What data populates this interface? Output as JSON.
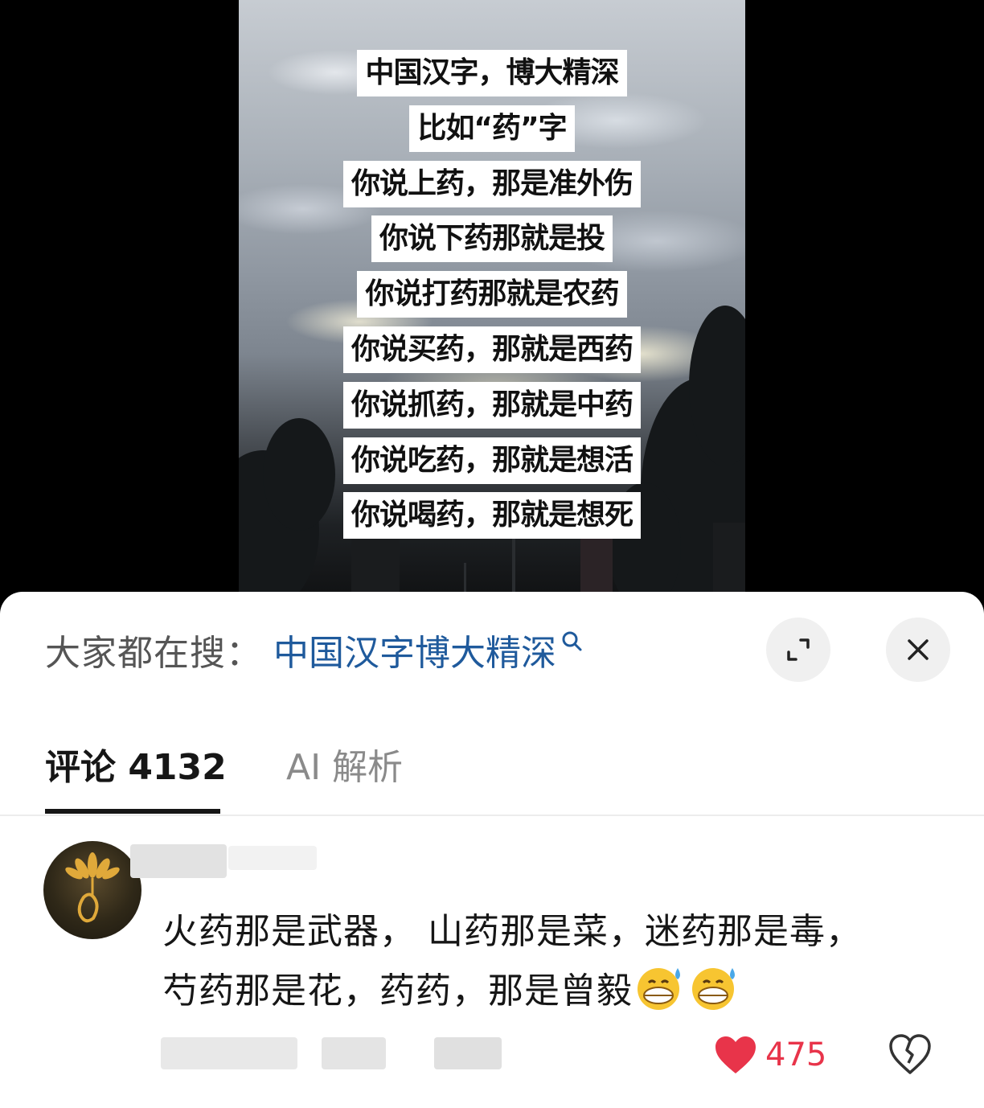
{
  "video": {
    "captions": [
      "中国汉字，博大精深",
      "比如“药”字",
      "你说上药，那是准外伤",
      "你说下药那就是投",
      "你说打药那就是农药",
      "你说买药，那就是西药",
      "你说抓药，那就是中药",
      "你说吃药，那就是想活",
      "你说喝药，那就是想死"
    ]
  },
  "hot_search": {
    "label": "大家都在搜：",
    "term": "中国汉字博大精深",
    "term_color": "#1f5a9c"
  },
  "tabs": {
    "comments_label": "评论 4132",
    "ai_label": "AI 解析"
  },
  "comment": {
    "text_line1": "火药那是武器，  山药那是菜，迷药那是毒，",
    "text_line2": "芍药那是花，药药，那是曾毅",
    "likes": "475",
    "like_color": "#e8344a"
  },
  "icons": {
    "expand": "expand-icon",
    "close": "close-icon",
    "search": "search-icon",
    "heart": "heart-icon",
    "dislike": "broken-heart-icon"
  }
}
